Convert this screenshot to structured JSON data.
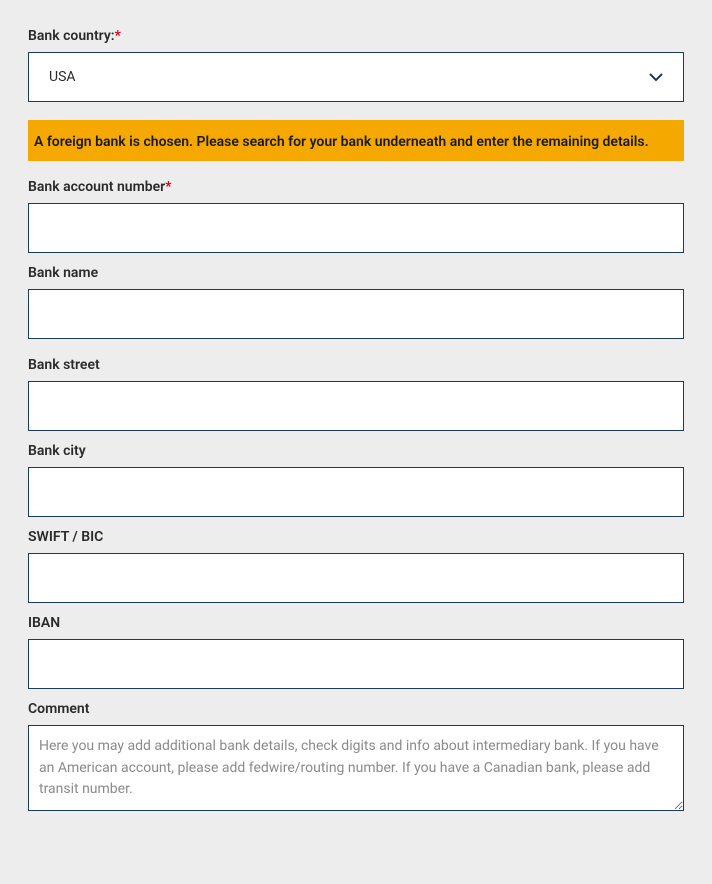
{
  "form": {
    "bankCountry": {
      "label": "Bank country:",
      "required": true,
      "value": "USA"
    },
    "alert": {
      "message": "A foreign bank is chosen. Please search for your bank underneath and enter the remaining details."
    },
    "bankAccountNumber": {
      "label": "Bank account number",
      "required": true,
      "value": ""
    },
    "bankName": {
      "label": "Bank name",
      "value": ""
    },
    "bankStreet": {
      "label": "Bank street",
      "value": ""
    },
    "bankCity": {
      "label": "Bank city",
      "value": ""
    },
    "swiftBic": {
      "label": "SWIFT / BIC",
      "value": ""
    },
    "iban": {
      "label": "IBAN",
      "value": ""
    },
    "comment": {
      "label": "Comment",
      "placeholder": "Here you may add additional bank details, check digits and info about intermediary bank. If you have an American account, please add fedwire/routing number. If you have a Canadian bank, please add transit number.",
      "value": ""
    },
    "requiredMark": "*"
  }
}
